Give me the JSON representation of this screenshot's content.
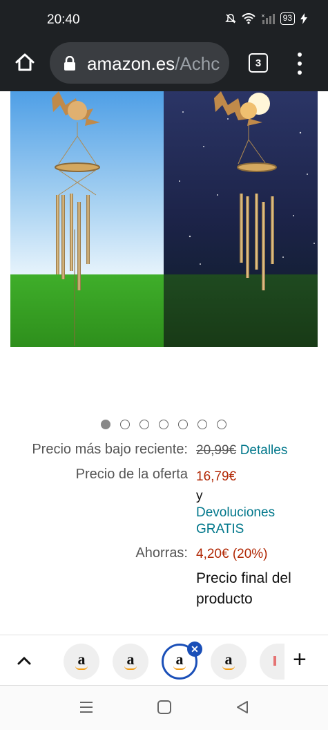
{
  "status_bar": {
    "time": "20:40",
    "battery": "93"
  },
  "browser": {
    "url_domain": "amazon.es",
    "url_path": "/Achc",
    "tab_count": "3"
  },
  "product": {
    "image_alt": "Carillón solar",
    "carousel_total": 7,
    "carousel_active": 1
  },
  "price": {
    "recent_low_label": "Precio más bajo reciente:",
    "recent_low_value": "20,99€",
    "details_link": "Detalles",
    "offer_label": "Precio de la oferta",
    "offer_value": "16,79€",
    "and_text": "y",
    "returns_line1": "Devoluciones",
    "returns_line2": "GRATIS",
    "savings_label": "Ahorras:",
    "savings_value": "4,20€ (20%)",
    "final_line1": "Precio final del",
    "final_line2": "producto"
  },
  "tab_strip": {
    "tab_letter": "a"
  },
  "colors": {
    "price_red": "#b12704",
    "link_teal": "#00778b",
    "tab_accent": "#1a4fb8"
  }
}
